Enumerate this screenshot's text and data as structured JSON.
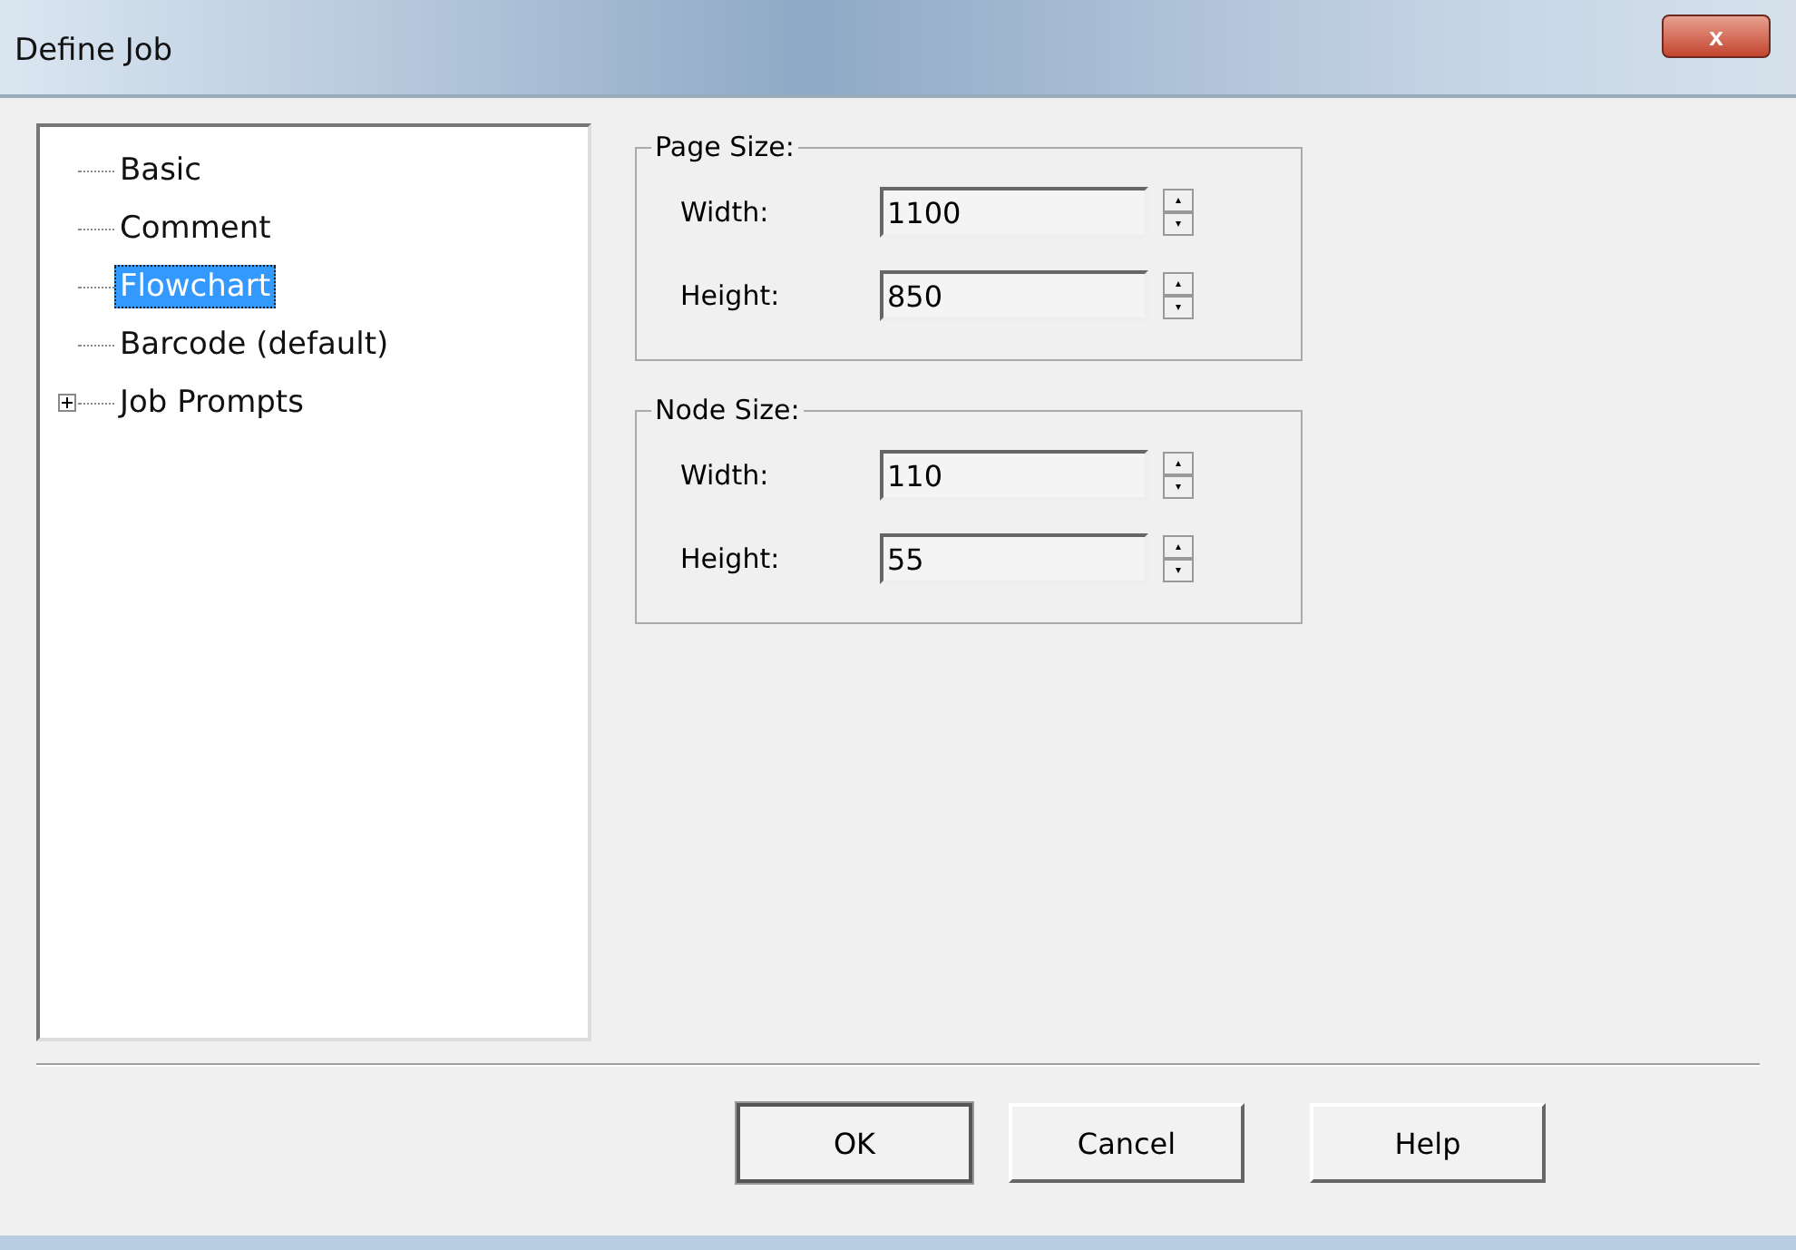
{
  "window": {
    "title": "Define Job",
    "close": "x"
  },
  "tree": [
    {
      "label": "Basic",
      "selected": false
    },
    {
      "label": "Comment",
      "selected": false
    },
    {
      "label": "Flowchart",
      "selected": true
    },
    {
      "label": "Barcode (default)",
      "selected": false
    },
    {
      "label": "Job Prompts",
      "selected": false,
      "expanded": false
    }
  ],
  "groups": [
    {
      "title": "Page Size:",
      "fields": [
        {
          "label": "Width:",
          "value": "1100"
        },
        {
          "label": "Height:",
          "value": "850"
        }
      ]
    },
    {
      "title": "Node Size:",
      "fields": [
        {
          "label": "Width:",
          "value": "110"
        },
        {
          "label": "Height:",
          "value": "55"
        }
      ]
    }
  ],
  "buttons": [
    {
      "label": "OK",
      "default": true
    },
    {
      "label": "Cancel",
      "default": false
    },
    {
      "label": "Help",
      "default": false
    }
  ]
}
